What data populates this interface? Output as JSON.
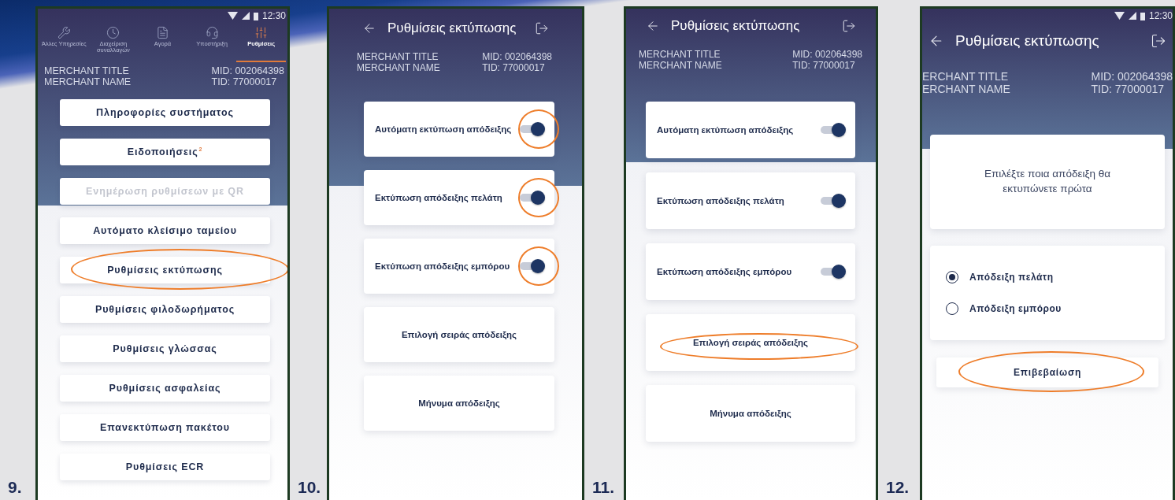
{
  "steps": [
    {
      "kind": "menu",
      "number": "9.",
      "status": {
        "time": "12:30"
      },
      "tabs": [
        {
          "label": "Άλλες Υπηρεσίες",
          "selected": false
        },
        {
          "label": "Διαχείριση συναλλαγών",
          "selected": false
        },
        {
          "label": "Αγορά",
          "selected": false
        },
        {
          "label": "Υποστήριξη",
          "selected": false
        },
        {
          "label": "Ρυθμίσεις",
          "selected": true
        }
      ],
      "merchant": {
        "title": "MERCHANT TITLE",
        "name": "MERCHANT NAME",
        "mid": "MID: 002064398",
        "tid": "TID: 77000017"
      },
      "items": [
        {
          "label": "Πληροφορίες συστήματος",
          "disabled": false,
          "circled": false
        },
        {
          "label": "Ειδοποιήσεις",
          "badge": "2",
          "disabled": false,
          "circled": false
        },
        {
          "label": "Ενημέρωση ρυθμίσεων με QR",
          "disabled": true,
          "circled": false
        },
        {
          "label": "Αυτόματο κλείσιμο ταμείου",
          "disabled": false,
          "circled": false
        },
        {
          "label": "Ρυθμίσεις εκτύπωσης",
          "disabled": false,
          "circled": true
        },
        {
          "label": "Ρυθμίσεις φιλοδωρήματος",
          "disabled": false,
          "circled": false
        },
        {
          "label": "Ρυθμίσεις γλώσσας",
          "disabled": false,
          "circled": false
        },
        {
          "label": "Ρυθμίσεις ασφαλείας",
          "disabled": false,
          "circled": false
        },
        {
          "label": "Επανεκτύπωση πακέτου",
          "disabled": false,
          "circled": false
        },
        {
          "label": "Ρυθμίσεις ECR",
          "disabled": false,
          "circled": false
        }
      ]
    },
    {
      "kind": "options",
      "number": "10.",
      "title": "Ρυθμίσεις εκτύπωσης",
      "merchant": {
        "title": "MERCHANT TITLE",
        "name": "MERCHANT NAME",
        "mid": "MID: 002064398",
        "tid": "TID: 77000017"
      },
      "options": [
        {
          "kind": "toggle",
          "label": "Αυτόματη εκτύπωση απόδειξης",
          "on": true,
          "circled": true
        },
        {
          "kind": "toggle",
          "label": "Εκτύπωση απόδειξης πελάτη",
          "on": true,
          "circled": true
        },
        {
          "kind": "toggle",
          "label": "Εκτύπωση απόδειξης εμπόρου",
          "on": true,
          "circled": true
        },
        {
          "kind": "button",
          "label": "Επιλογή σειράς απόδειξης",
          "circled": false
        },
        {
          "kind": "button",
          "label": "Μήνυμα απόδειξης",
          "circled": false
        }
      ]
    },
    {
      "kind": "options",
      "number": "11.",
      "title": "Ρυθμίσεις εκτύπωσης",
      "merchant": {
        "title": "MERCHANT TITLE",
        "name": "MERCHANT NAME",
        "mid": "MID: 002064398",
        "tid": "TID: 77000017"
      },
      "options": [
        {
          "kind": "toggle",
          "label": "Αυτόματη εκτύπωση απόδειξης",
          "on": true,
          "circled": false
        },
        {
          "kind": "toggle",
          "label": "Εκτύπωση απόδειξης πελάτη",
          "on": true,
          "circled": false
        },
        {
          "kind": "toggle",
          "label": "Εκτύπωση απόδειξης εμπόρου",
          "on": true,
          "circled": false
        },
        {
          "kind": "button",
          "label": "Επιλογή σειράς απόδειξης",
          "circled": true
        },
        {
          "kind": "button",
          "label": "Μήνυμα απόδειξης",
          "circled": false
        }
      ]
    },
    {
      "kind": "order",
      "number": "12.",
      "status": {
        "time": "12:30"
      },
      "title": "Ρυθμίσεις εκτύπωσης",
      "merchant": {
        "title": "ERCHANT TITLE",
        "name": "ERCHANT NAME",
        "mid": "MID: 002064398",
        "tid": "TID: 77000017"
      },
      "prompt": "Επιλέξτε ποια απόδειξη θα εκτυπώνετε πρώτα",
      "choices": [
        {
          "label": "Απόδειξη πελάτη",
          "selected": true
        },
        {
          "label": "Απόδειξη εμπόρου",
          "selected": false
        }
      ],
      "confirm": {
        "label": "Επιβεβαίωση",
        "circled": true
      }
    }
  ]
}
